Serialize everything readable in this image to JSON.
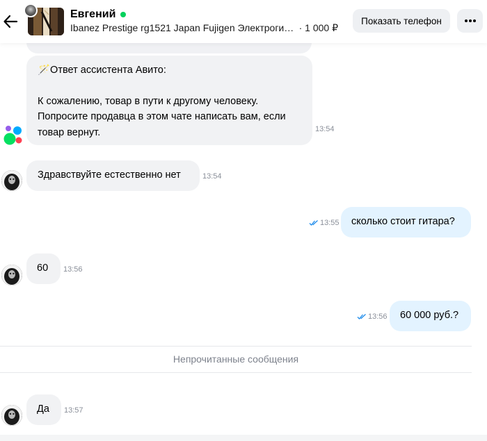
{
  "header": {
    "seller_name": "Евгений",
    "item_title": "Ibanez Prestige rg1521 Japan Fujigen Электрогита...",
    "item_price": "· 1 000 ₽",
    "show_phone_label": "Показать телефон",
    "online_color": "#02d15c",
    "icons": {
      "back": "arrow-left-icon",
      "more": "more-horizontal-icon"
    }
  },
  "messages": [
    {
      "direction": "incoming",
      "sender": "assistant",
      "title": "🪄Ответ ассистента Авито:",
      "lines": [
        "К сожалению, товар в пути к другому человеку.",
        "Попросите продавца в этом чате написать вам, если",
        "товар вернут."
      ],
      "time": "13:54"
    },
    {
      "direction": "incoming",
      "sender": "seller",
      "text": "Здравствуйте естественно нет",
      "time": "13:54"
    },
    {
      "direction": "outgoing",
      "text": "сколько стоит гитара?",
      "time": "13:55",
      "read": true
    },
    {
      "direction": "incoming",
      "sender": "seller",
      "text": "60",
      "time": "13:56"
    },
    {
      "direction": "outgoing",
      "text": "60 000 руб.?",
      "time": "13:56",
      "read": true
    },
    {
      "direction": "incoming",
      "sender": "seller",
      "text": "Да",
      "time": "13:57"
    }
  ],
  "unread_divider": "Непрочитанные сообщения",
  "colors": {
    "incoming_bubble": "#f1f2f4",
    "outgoing_bubble": "#e3f3ff",
    "read_check": "#1f8ceb",
    "timestamp": "#8a8f99",
    "avito_dots": [
      "#0af",
      "#04e061",
      "#ff4053",
      "#965eeb"
    ]
  }
}
